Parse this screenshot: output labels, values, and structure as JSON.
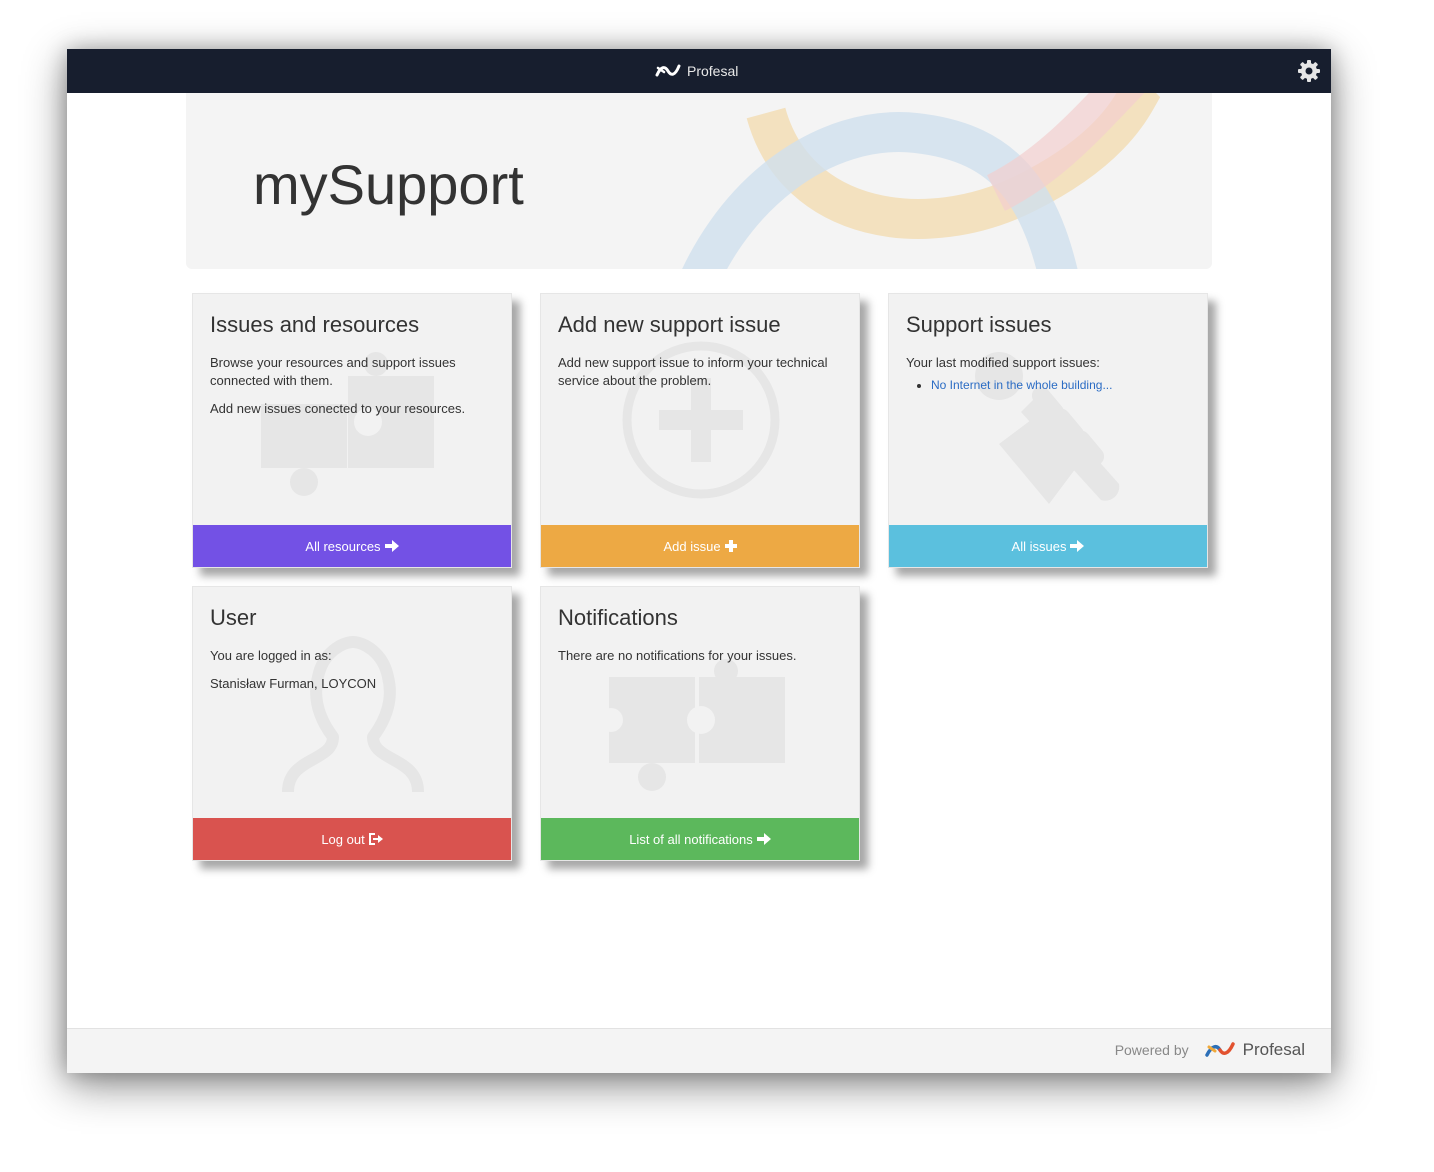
{
  "topbar": {
    "brand": "Profesal",
    "settings_icon": "gear-icon"
  },
  "jumbotron": {
    "title": "mySupport"
  },
  "cards": {
    "issues_resources": {
      "title": "Issues and resources",
      "paragraphs": [
        "Browse your resources and support issues connected with them.",
        "Add new issues conected to your resources."
      ],
      "button": "All resources",
      "button_icon": "arrow-right-icon",
      "bg_icon": "puzzle-icon",
      "color": "#7351e5"
    },
    "add_issue": {
      "title": "Add new support issue",
      "paragraphs": [
        "Add new support issue to inform your technical service about the problem."
      ],
      "button": "Add issue",
      "button_icon": "plus-icon",
      "bg_icon": "plus-circle-icon",
      "color": "#eda944"
    },
    "support_issues": {
      "title": "Support issues",
      "intro": "Your last modified support issues:",
      "issues": [
        "No Internet in the whole building..."
      ],
      "button": "All issues",
      "button_icon": "arrow-right-icon",
      "bg_icon": "wrench-hand-icon",
      "color": "#5bc0de"
    },
    "user": {
      "title": "User",
      "paragraphs": [
        "You are logged in as:",
        "Stanisław Furman, LOYCON"
      ],
      "button": "Log out",
      "button_icon": "logout-icon",
      "bg_icon": "user-icon",
      "color": "#d9534f"
    },
    "notifications": {
      "title": "Notifications",
      "paragraphs": [
        "There are no notifications for your issues."
      ],
      "button": "List of all notifications",
      "button_icon": "arrow-right-icon",
      "bg_icon": "puzzle-icon",
      "color": "#5cb85c"
    }
  },
  "footer": {
    "powered_by": "Powered by",
    "brand": "Profesal"
  }
}
